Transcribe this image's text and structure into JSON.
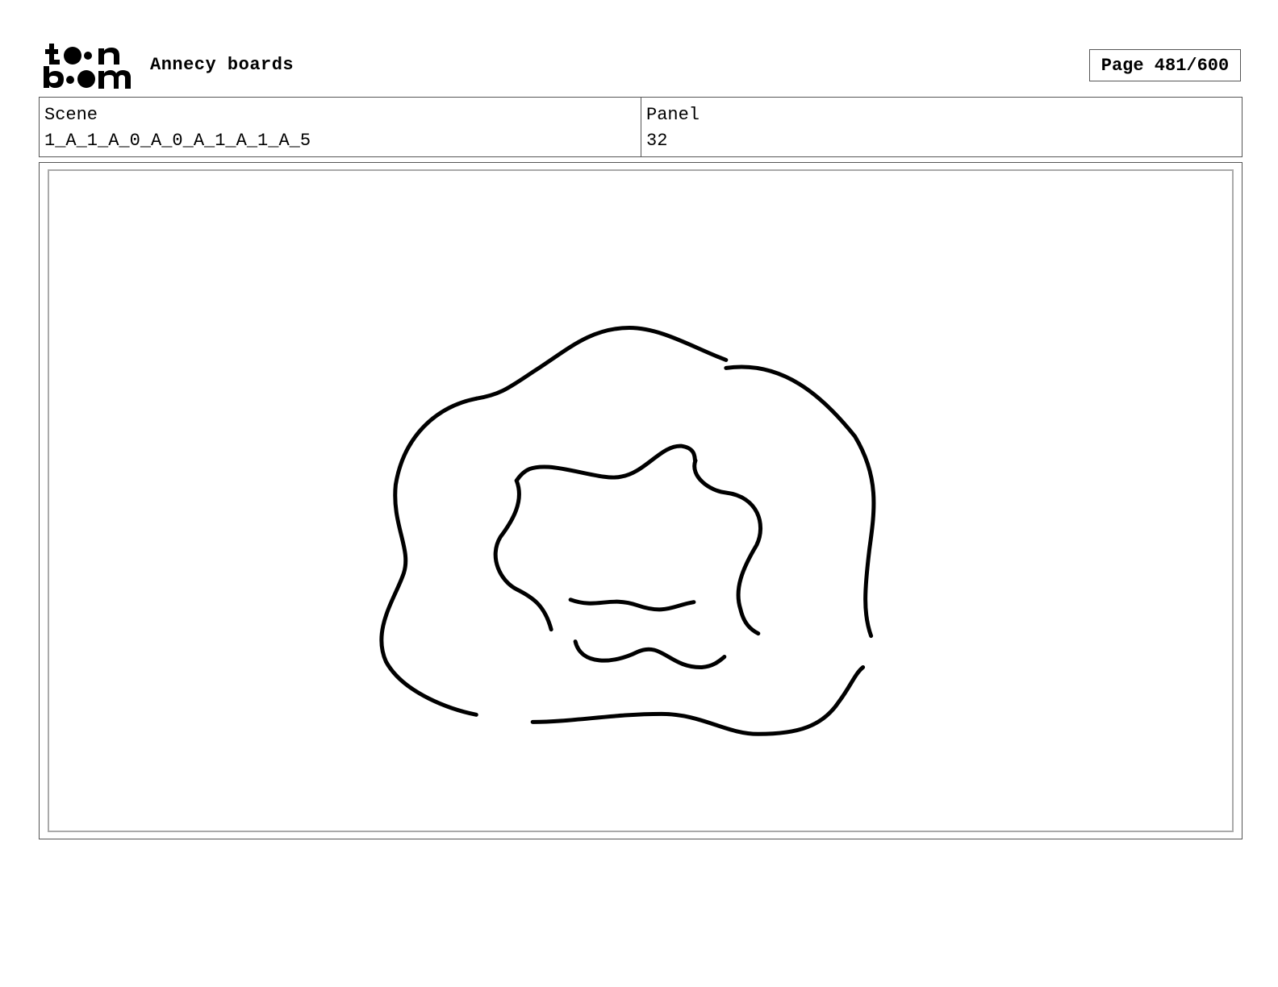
{
  "header": {
    "logo_text_top": "toon",
    "logo_text_bottom": "boom",
    "title": "Annecy boards",
    "page_label": "Page 481/600"
  },
  "info": {
    "scene_label": "Scene",
    "scene_value": "1_A_1_A_0_A_0_A_1_A_1_A_5",
    "panel_label": "Panel",
    "panel_value": "32"
  },
  "drawing": {
    "stroke_color": "#000000",
    "frame_color": "#aaaaaa"
  }
}
